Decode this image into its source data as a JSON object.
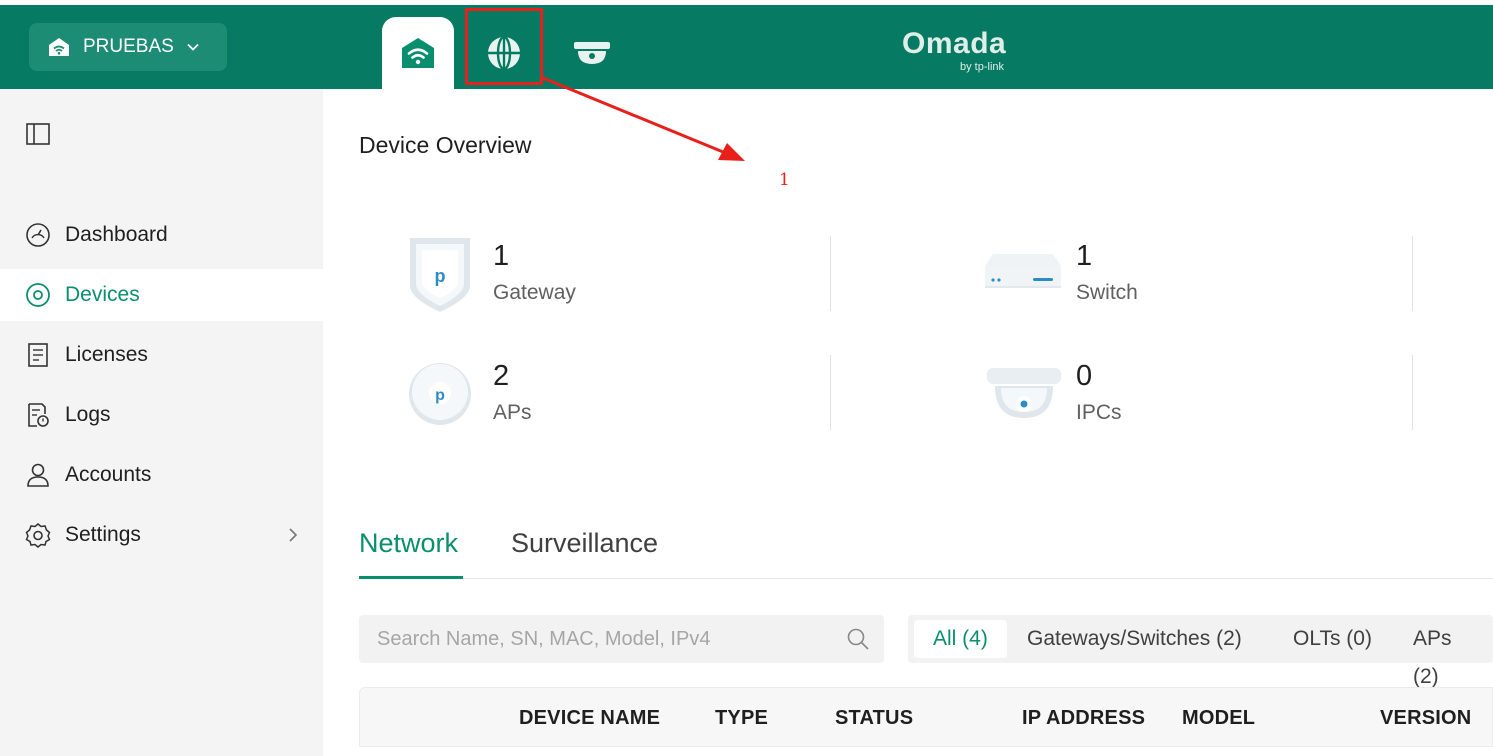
{
  "topbar": {
    "site_name": "PRUEBAS",
    "logo": "Omada",
    "logo_sub": "by tp-link",
    "tabs": [
      {
        "icon": "wifi-home-icon"
      },
      {
        "icon": "globe-icon"
      },
      {
        "icon": "camera-icon"
      }
    ]
  },
  "annotation": {
    "label": "1",
    "color": "#e8201c"
  },
  "sidebar": {
    "items": [
      {
        "label": "Dashboard",
        "icon": "dashboard-gauge-icon"
      },
      {
        "label": "Devices",
        "icon": "devices-icon",
        "active": true
      },
      {
        "label": "Licenses",
        "icon": "license-icon"
      },
      {
        "label": "Logs",
        "icon": "logs-icon"
      },
      {
        "label": "Accounts",
        "icon": "user-icon"
      },
      {
        "label": "Settings",
        "icon": "gear-icon"
      }
    ]
  },
  "main": {
    "title": "Device Overview",
    "overview": [
      {
        "count": "1",
        "label": "Gateway",
        "icon": "gateway-icon"
      },
      {
        "count": "1",
        "label": "Switch",
        "icon": "switch-icon"
      },
      {
        "count": "2",
        "label": "APs",
        "icon": "ap-icon"
      },
      {
        "count": "0",
        "label": "IPCs",
        "icon": "ipc-camera-icon"
      }
    ],
    "tabs": [
      "Network",
      "Surveillance"
    ],
    "search_placeholder": "Search Name, SN, MAC, Model, IPv4",
    "filters": [
      "All (4)",
      "Gateways/Switches (2)",
      "OLTs (0)",
      "APs (2)"
    ],
    "columns": [
      "DEVICE NAME",
      "TYPE",
      "STATUS",
      "IP ADDRESS",
      "MODEL",
      "VERSION"
    ]
  },
  "colors": {
    "brand": "#077a63",
    "accent": "#0a8f6e",
    "annotation": "#e8201c"
  }
}
